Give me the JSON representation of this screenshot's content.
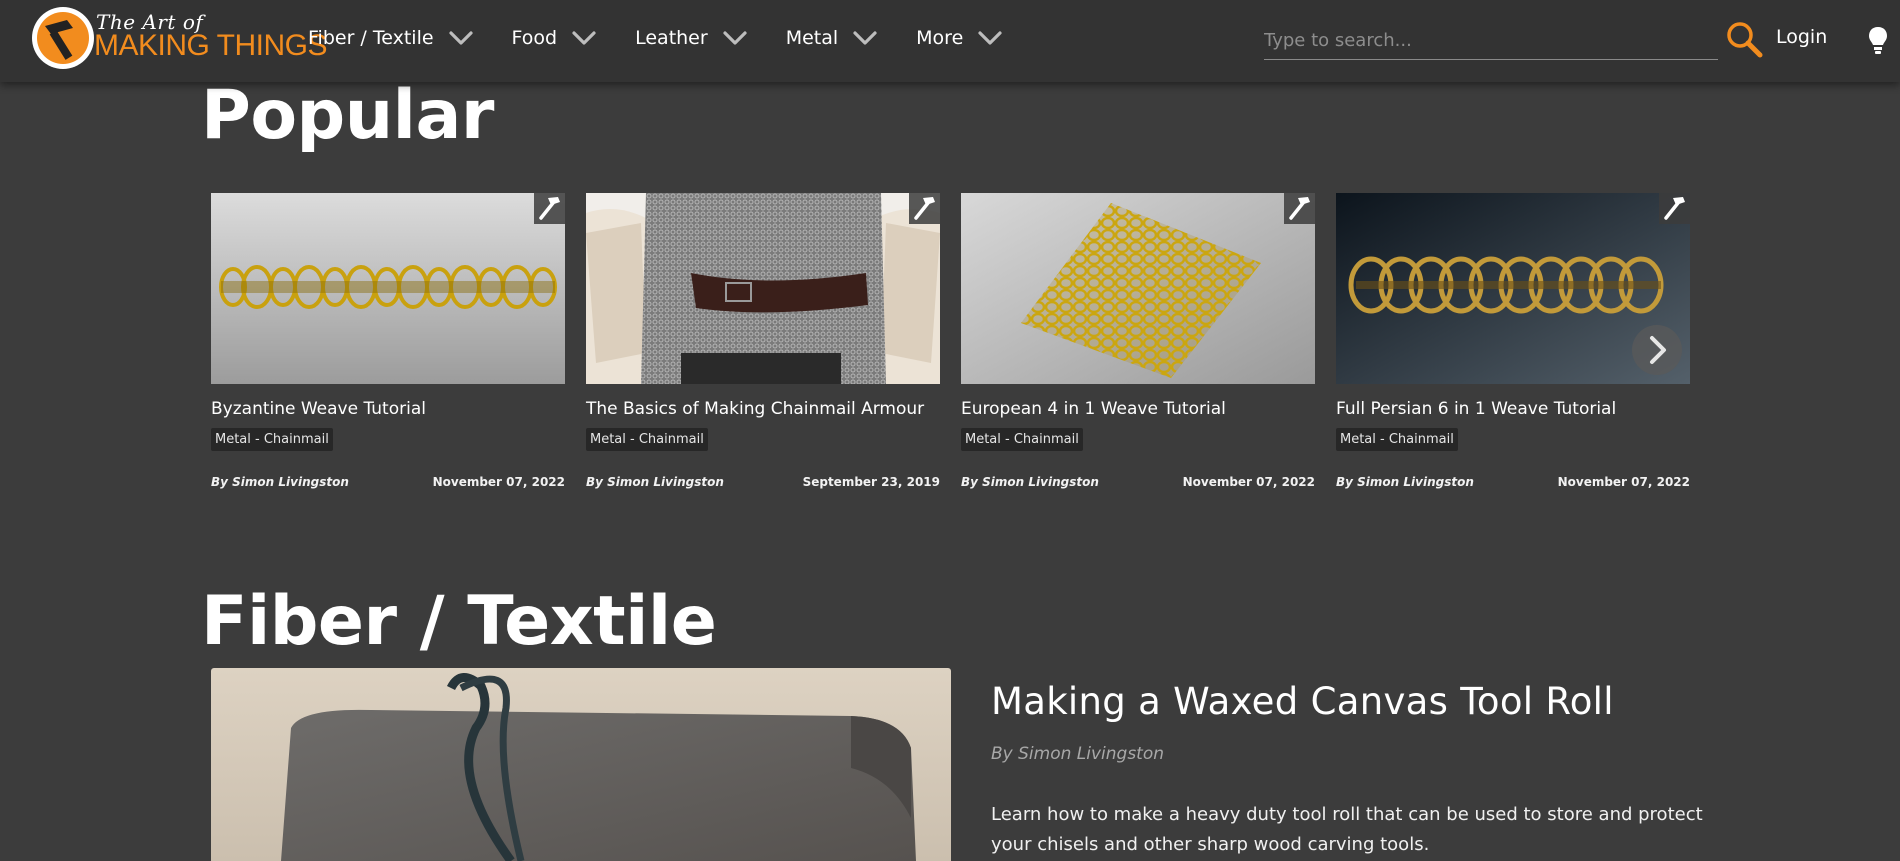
{
  "header": {
    "logo_line1": "The Art of",
    "logo_line2": "MAKING THINGS",
    "nav": [
      {
        "label": "Fiber / Textile",
        "icon": "chevron-down-icon"
      },
      {
        "label": "Food",
        "icon": "chevron-down-icon"
      },
      {
        "label": "Leather",
        "icon": "chevron-down-icon"
      },
      {
        "label": "Metal",
        "icon": "chevron-down-icon"
      },
      {
        "label": "More",
        "icon": "chevron-down-icon"
      }
    ],
    "search_placeholder": "Type to search...",
    "search_value": "",
    "login_label": "Login",
    "accent_color": "#f28c1e"
  },
  "popular": {
    "title": "Popular",
    "cards": [
      {
        "title": "Byzantine Weave Tutorial",
        "tag": "Metal - Chainmail",
        "author": "By Simon Livingston",
        "date": "November 07, 2022"
      },
      {
        "title": "The Basics of Making Chainmail Armour",
        "tag": "Metal - Chainmail",
        "author": "By Simon Livingston",
        "date": "September 23, 2019"
      },
      {
        "title": "European 4 in 1 Weave Tutorial",
        "tag": "Metal - Chainmail",
        "author": "By Simon Livingston",
        "date": "November 07, 2022"
      },
      {
        "title": "Full Persian 6 in 1 Weave Tutorial",
        "tag": "Metal - Chainmail",
        "author": "By Simon Livingston",
        "date": "November 07, 2022"
      }
    ]
  },
  "fiber_textile": {
    "title": "Fiber / Textile",
    "feature": {
      "title": "Making a Waxed Canvas Tool Roll",
      "author": "By Simon Livingston",
      "description": "Learn how to make a heavy duty tool roll that can be used to store and protect your chisels and other sharp wood carving tools."
    }
  }
}
